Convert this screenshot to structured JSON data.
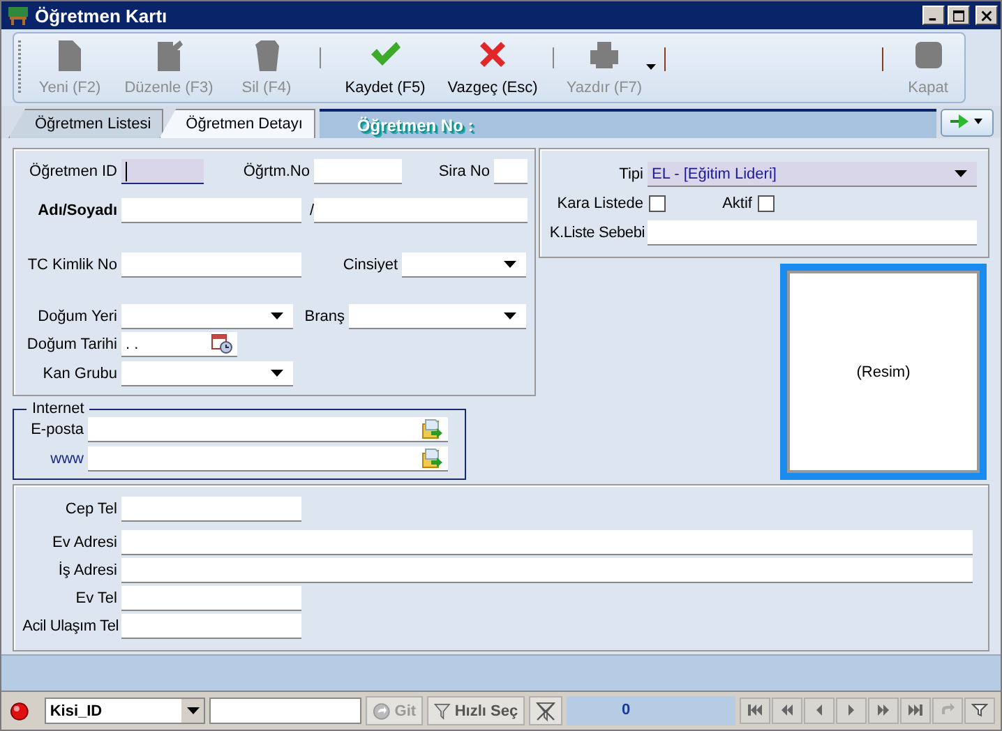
{
  "window": {
    "title": "Öğretmen Kartı"
  },
  "toolbar": [
    {
      "label": "Yeni (F2)",
      "disabled": true
    },
    {
      "label": "Düzenle (F3)",
      "disabled": true
    },
    {
      "label": "Sil (F4)",
      "disabled": true
    },
    {
      "label": "Kaydet (F5)",
      "disabled": false
    },
    {
      "label": "Vazgeç (Esc)",
      "disabled": false
    },
    {
      "label": "Yazdır (F7)",
      "disabled": true
    },
    {
      "label": "Kapat",
      "disabled": true
    }
  ],
  "tabs": [
    {
      "label": "Öğretmen Listesi",
      "selected": false
    },
    {
      "label": "Öğretmen Detayı",
      "selected": true
    }
  ],
  "tab_strip_label": "Öğretmen No :",
  "identity": {
    "rows": [
      [
        {
          "label": "Öğretmen ID",
          "kind": "text",
          "highlighted": true,
          "focused": true
        },
        {
          "label": "Öğrtm.No",
          "kind": "text"
        },
        {
          "label": "Sira No",
          "kind": "text"
        }
      ],
      [
        {
          "label": "Adı/Soyadı",
          "kind": "text",
          "bold": true
        },
        {
          "label": "/",
          "kind": "text"
        }
      ],
      [
        {
          "label": "TC Kimlik No",
          "kind": "text"
        },
        {
          "label": "Cinsiyet",
          "kind": "combo"
        }
      ],
      [
        {
          "label": "Doğum Yeri",
          "kind": "combo"
        },
        {
          "label": "Branş",
          "kind": "combo"
        }
      ],
      [
        {
          "label": "Doğum Tarihi",
          "kind": "date",
          "value": ". ."
        }
      ],
      [
        {
          "label": "Kan Grubu",
          "kind": "combo"
        }
      ]
    ]
  },
  "type_panel": {
    "rows": [
      [
        {
          "label": "Tipi",
          "kind": "combo",
          "value": "EL - [Eğitim Lideri]",
          "highlighted": true
        }
      ],
      [
        {
          "label": "Kara Listede",
          "kind": "checkbox",
          "checked": false
        },
        {
          "label": "Aktif",
          "kind": "checkbox",
          "checked": false
        }
      ],
      [
        {
          "label": "K.Liste Sebebi",
          "kind": "text"
        }
      ]
    ]
  },
  "photo": {
    "caption": "(Resim)"
  },
  "internet": {
    "title": "Internet",
    "rows": [
      [
        {
          "label": "E-posta",
          "kind": "url"
        }
      ],
      [
        {
          "label": "www",
          "kind": "url",
          "link": true
        }
      ]
    ]
  },
  "contact": {
    "rows": [
      [
        {
          "label": "Cep Tel",
          "kind": "text"
        }
      ],
      [
        {
          "label": "Ev Adresi",
          "kind": "text"
        }
      ],
      [
        {
          "label": "İş Adresi",
          "kind": "text"
        }
      ],
      [
        {
          "label": "Ev Tel",
          "kind": "text"
        }
      ],
      [
        {
          "label": "Acil Ulaşım Tel",
          "kind": "text"
        }
      ]
    ]
  },
  "status_bar": {
    "field": "Kisi_ID",
    "buttons": [
      {
        "label": "Git",
        "disabled": true
      },
      {
        "label": "Hızlı Seç",
        "disabled": false
      }
    ],
    "count": "0"
  }
}
